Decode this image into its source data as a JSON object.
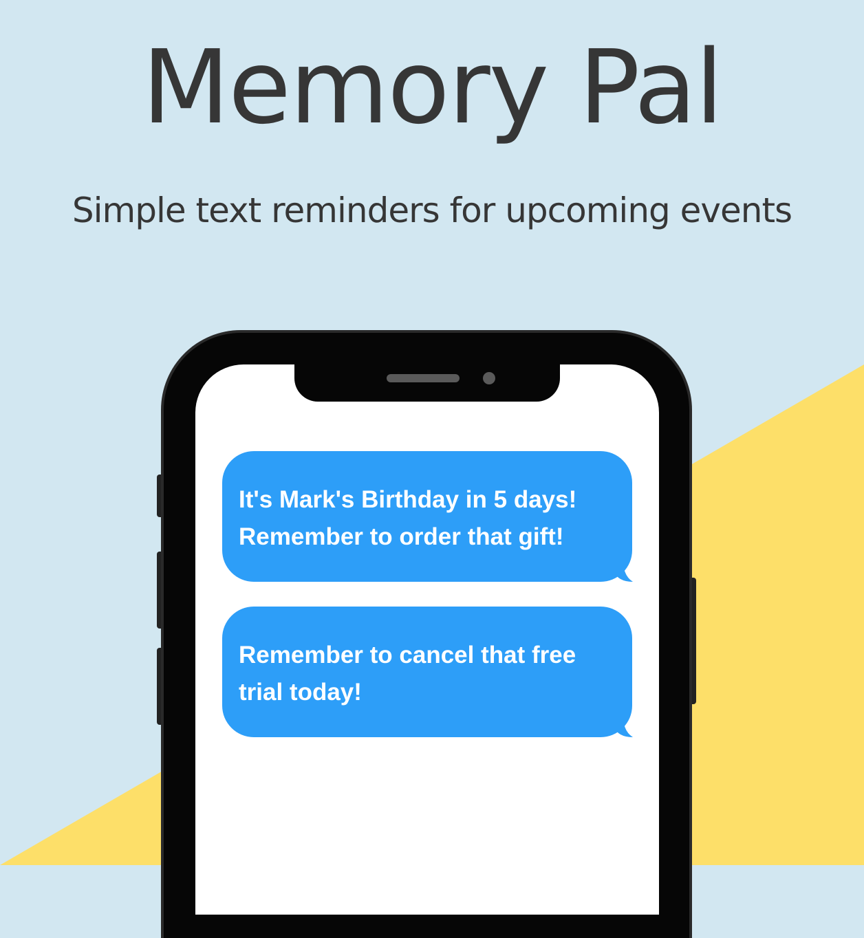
{
  "app": {
    "title": "Memory Pal",
    "subtitle": "Simple text reminders for upcoming events"
  },
  "colors": {
    "background": "#d2e7f1",
    "accent_yellow": "#fddf69",
    "bubble_blue": "#2d9ef8",
    "text_dark": "#363636",
    "phone_body": "#060606"
  },
  "messages": [
    {
      "text": "It's Mark's Birthday in 5 days! Remember to order that gift!"
    },
    {
      "text": "Remember to cancel that free trial today!"
    }
  ]
}
